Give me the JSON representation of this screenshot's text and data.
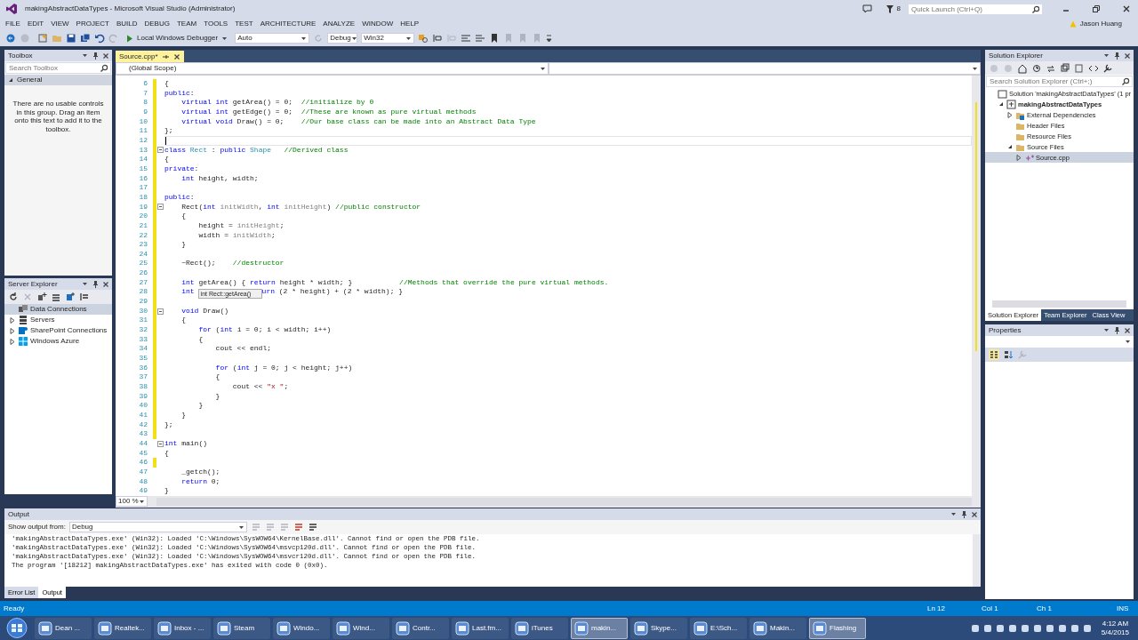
{
  "window": {
    "title": "makingAbstractDataTypes - Microsoft Visual Studio (Administrator)"
  },
  "notifications": {
    "count": "8"
  },
  "quick_launch": {
    "placeholder": "Quick Launch (Ctrl+Q)"
  },
  "menu": [
    "FILE",
    "EDIT",
    "VIEW",
    "PROJECT",
    "BUILD",
    "DEBUG",
    "TEAM",
    "TOOLS",
    "TEST",
    "ARCHITECTURE",
    "ANALYZE",
    "WINDOW",
    "HELP"
  ],
  "user": {
    "name": "Jason Huang"
  },
  "toolbar": {
    "debugger": "Local Windows Debugger",
    "dropdowns": [
      "Auto",
      "Debug",
      "Win32"
    ]
  },
  "toolbox": {
    "title": "Toolbox",
    "search": {
      "placeholder": "Search Toolbox"
    },
    "group": {
      "label": "General",
      "expanded": true
    },
    "empty_message": "There are no usable controls in this group. Drag an item onto this text to add it to the toolbox."
  },
  "server_explorer": {
    "title": "Server Explorer",
    "items": [
      {
        "label": "Data Connections",
        "kind": "data",
        "selected": true
      },
      {
        "label": "Servers",
        "kind": "servers",
        "expanded": false,
        "selected": false
      },
      {
        "label": "SharePoint Connections",
        "kind": "sharepoint",
        "expanded": false,
        "selected": false
      },
      {
        "label": "Windows Azure",
        "kind": "azure",
        "expanded": false,
        "selected": false
      }
    ]
  },
  "editor": {
    "tabs": [
      {
        "label": "Source.cpp*",
        "selected": true
      }
    ],
    "scope": "(Global Scope)",
    "zoom": "100 %",
    "lines": [
      {
        "num": "6",
        "changed": true,
        "fold": false,
        "current": false,
        "tokens": [
          "{"
        ]
      },
      {
        "num": "7",
        "changed": true,
        "fold": false,
        "current": false,
        "tokens": [
          {
            "kind": "kw",
            "text": "public"
          },
          ":"
        ]
      },
      {
        "num": "8",
        "changed": true,
        "fold": false,
        "current": false,
        "tokens": [
          {
            "kind": "kw",
            "text": "    virtual int"
          },
          " getArea() = 0;  ",
          {
            "kind": "cm",
            "text": "//initialize by 0"
          }
        ]
      },
      {
        "num": "9",
        "changed": true,
        "fold": false,
        "current": false,
        "tokens": [
          {
            "kind": "kw",
            "text": "    virtual int"
          },
          " getEdge() = 0;  ",
          {
            "kind": "cm",
            "text": "//These are known as pure virtual methods"
          }
        ]
      },
      {
        "num": "10",
        "changed": true,
        "fold": false,
        "current": false,
        "tokens": [
          {
            "kind": "kw",
            "text": "    virtual void"
          },
          " Draw() = 0;    ",
          {
            "kind": "cm",
            "text": "//Our base class can be made into an Abstract Data Type"
          }
        ]
      },
      {
        "num": "11",
        "changed": true,
        "fold": false,
        "current": false,
        "tokens": [
          "};"
        ]
      },
      {
        "num": "12",
        "changed": true,
        "fold": false,
        "current": true
      },
      {
        "num": "13",
        "changed": true,
        "fold": true,
        "current": false,
        "tokens": [
          {
            "kind": "kw",
            "text": "class "
          },
          {
            "kind": "type",
            "text": "Rect"
          },
          " : ",
          {
            "kind": "kw",
            "text": "public "
          },
          {
            "kind": "type",
            "text": "Shape   "
          },
          {
            "kind": "cm",
            "text": "//Derived class"
          }
        ]
      },
      {
        "num": "14",
        "changed": true,
        "fold": false,
        "current": false,
        "tokens": [
          "{"
        ]
      },
      {
        "num": "15",
        "changed": true,
        "fold": false,
        "current": false,
        "tokens": [
          {
            "kind": "kw",
            "text": "private"
          },
          ":"
        ]
      },
      {
        "num": "16",
        "changed": true,
        "fold": false,
        "current": false,
        "tokens": [
          {
            "kind": "kw",
            "text": "    int"
          },
          " height, width;"
        ]
      },
      {
        "num": "17",
        "changed": true,
        "fold": false,
        "current": false
      },
      {
        "num": "18",
        "changed": true,
        "fold": false,
        "current": false,
        "tokens": [
          {
            "kind": "kw",
            "text": "public"
          },
          ":"
        ]
      },
      {
        "num": "19",
        "changed": true,
        "fold": true,
        "current": false,
        "tokens": [
          "    Rect(",
          {
            "kind": "kw",
            "text": "int "
          },
          {
            "kind": "param",
            "text": "initWidth"
          },
          ", ",
          {
            "kind": "kw",
            "text": "int "
          },
          {
            "kind": "param",
            "text": "initHeight"
          },
          ") ",
          {
            "kind": "cm",
            "text": "//public constructor"
          }
        ]
      },
      {
        "num": "20",
        "changed": true,
        "fold": false,
        "current": false,
        "tokens": [
          "    {"
        ]
      },
      {
        "num": "21",
        "changed": true,
        "fold": false,
        "current": false,
        "tokens": [
          "        height = ",
          {
            "kind": "param",
            "text": "initHeight"
          },
          ";"
        ]
      },
      {
        "num": "22",
        "changed": true,
        "fold": false,
        "current": false,
        "tokens": [
          "        width = ",
          {
            "kind": "param",
            "text": "initWidth"
          },
          ";"
        ]
      },
      {
        "num": "23",
        "changed": true,
        "fold": false,
        "current": false,
        "tokens": [
          "    }"
        ]
      },
      {
        "num": "24",
        "changed": true,
        "fold": false,
        "current": false
      },
      {
        "num": "25",
        "changed": true,
        "fold": false,
        "current": false,
        "tokens": [
          "    ~Rect();    ",
          {
            "kind": "cm",
            "text": "//destructor"
          }
        ]
      },
      {
        "num": "26",
        "changed": true,
        "fold": false,
        "current": false
      },
      {
        "num": "27",
        "changed": true,
        "fold": false,
        "current": false,
        "tokens": [
          {
            "kind": "kw",
            "text": "    int"
          },
          " getArea() { ",
          {
            "kind": "kw",
            "text": "return"
          },
          " height * width; }           ",
          {
            "kind": "cm",
            "text": "//Methods that override the pure virtual methods."
          }
        ]
      },
      {
        "num": "28",
        "changed": true,
        "fold": false,
        "current": false,
        "tokens": [
          {
            "kind": "kw",
            "text": "    int"
          }
        ],
        "tooltip": "int Rect::getArea()",
        "tail": [
          {
            "kind": "kw",
            "text": "urn"
          },
          " (2 * height) + (2 * width); }"
        ]
      },
      {
        "num": "29",
        "changed": true,
        "fold": false,
        "current": false
      },
      {
        "num": "30",
        "changed": true,
        "fold": true,
        "current": false,
        "tokens": [
          {
            "kind": "kw",
            "text": "    void"
          },
          " Draw()"
        ]
      },
      {
        "num": "31",
        "changed": true,
        "fold": false,
        "current": false,
        "tokens": [
          "    {"
        ]
      },
      {
        "num": "32",
        "changed": true,
        "fold": false,
        "current": false,
        "tokens": [
          {
            "kind": "kw",
            "text": "        for"
          },
          " (",
          {
            "kind": "kw",
            "text": "int"
          },
          " i = 0; i < width; i++)"
        ]
      },
      {
        "num": "33",
        "changed": true,
        "fold": false,
        "current": false,
        "tokens": [
          "        {"
        ]
      },
      {
        "num": "34",
        "changed": true,
        "fold": false,
        "current": false,
        "tokens": [
          "            cout << endl;"
        ]
      },
      {
        "num": "35",
        "changed": true,
        "fold": false,
        "current": false
      },
      {
        "num": "36",
        "changed": true,
        "fold": false,
        "current": false,
        "tokens": [
          {
            "kind": "kw",
            "text": "            for"
          },
          " (",
          {
            "kind": "kw",
            "text": "int"
          },
          " j = 0; j < height; j++)"
        ]
      },
      {
        "num": "37",
        "changed": true,
        "fold": false,
        "current": false,
        "tokens": [
          "            {"
        ]
      },
      {
        "num": "38",
        "changed": true,
        "fold": false,
        "current": false,
        "tokens": [
          "                cout << ",
          {
            "kind": "str",
            "text": "\"x \""
          },
          ";"
        ]
      },
      {
        "num": "39",
        "changed": true,
        "fold": false,
        "current": false,
        "tokens": [
          "            }"
        ]
      },
      {
        "num": "40",
        "changed": true,
        "fold": false,
        "current": false,
        "tokens": [
          "        }"
        ]
      },
      {
        "num": "41",
        "changed": true,
        "fold": false,
        "current": false,
        "tokens": [
          "    }"
        ]
      },
      {
        "num": "42",
        "changed": true,
        "fold": false,
        "current": false,
        "tokens": [
          "};"
        ]
      },
      {
        "num": "43",
        "changed": true,
        "fold": false,
        "current": false
      },
      {
        "num": "44",
        "changed": false,
        "fold": true,
        "current": false,
        "tokens": [
          {
            "kind": "kw",
            "text": "int"
          },
          " main()"
        ]
      },
      {
        "num": "45",
        "changed": false,
        "fold": false,
        "current": false,
        "tokens": [
          "{"
        ]
      },
      {
        "num": "46",
        "changed": true,
        "fold": false,
        "current": false
      },
      {
        "num": "47",
        "changed": false,
        "fold": false,
        "current": false,
        "tokens": [
          "    _getch();"
        ]
      },
      {
        "num": "48",
        "changed": false,
        "fold": false,
        "current": false,
        "tokens": [
          {
            "kind": "kw",
            "text": "    return"
          },
          " 0;"
        ]
      },
      {
        "num": "49",
        "changed": false,
        "fold": false,
        "current": false,
        "tokens": [
          "}"
        ]
      }
    ]
  },
  "solution_explorer": {
    "title": "Solution Explorer",
    "search": {
      "placeholder": "Search Solution Explorer (Ctrl+;)"
    },
    "tree": [
      {
        "label": "Solution 'makingAbstractDataTypes' (1 pr",
        "kind": "solution",
        "selected": false,
        "children": [
          {
            "label": "makingAbstractDataTypes",
            "kind": "project",
            "expanded": true,
            "selected": false,
            "children": [
              {
                "label": "External Dependencies",
                "kind": "deps",
                "expanded": false,
                "selected": false
              },
              {
                "label": "Header Files",
                "kind": "folder",
                "selected": false
              },
              {
                "label": "Resource Files",
                "kind": "folder",
                "selected": false
              },
              {
                "label": "Source Files",
                "kind": "folder",
                "expanded": true,
                "selected": false,
                "children": [
                  {
                    "label": "Source.cpp",
                    "kind": "file",
                    "expanded": false,
                    "selected": true
                  }
                ]
              }
            ]
          }
        ]
      }
    ],
    "tabs": [
      {
        "label": "Solution Explorer",
        "selected": true
      },
      {
        "label": "Team Explorer",
        "selected": false
      },
      {
        "label": "Class View",
        "selected": false
      }
    ]
  },
  "properties": {
    "title": "Properties"
  },
  "output": {
    "title": "Output",
    "source_label": "Show output from:",
    "source": "Debug",
    "lines": [
      "'makingAbstractDataTypes.exe' (Win32): Loaded 'C:\\Windows\\SysWOW64\\KernelBase.dll'. Cannot find or open the PDB file.",
      "'makingAbstractDataTypes.exe' (Win32): Loaded 'C:\\Windows\\SysWOW64\\msvcp120d.dll'. Cannot find or open the PDB file.",
      "'makingAbstractDataTypes.exe' (Win32): Loaded 'C:\\Windows\\SysWOW64\\msvcr120d.dll'. Cannot find or open the PDB file.",
      "The program '[18212] makingAbstractDataTypes.exe' has exited with code 0 (0x0)."
    ]
  },
  "bottom_tabs": [
    {
      "label": "Error List",
      "selected": false
    },
    {
      "label": "Output",
      "selected": true
    }
  ],
  "status_bar": {
    "state": "Ready",
    "line": "Ln 12",
    "column": "Col 1",
    "char": "Ch 1",
    "mode": "INS"
  },
  "taskbar": {
    "items": [
      {
        "label": "Dean ...",
        "selected": false
      },
      {
        "label": "Realtek...",
        "selected": false
      },
      {
        "label": "Inbox - ...",
        "selected": false
      },
      {
        "label": "Steam",
        "selected": false
      },
      {
        "label": "Windo...",
        "selected": false
      },
      {
        "label": "Wind...",
        "selected": false
      },
      {
        "label": "Contr...",
        "selected": false
      },
      {
        "label": "Last.fm...",
        "selected": false
      },
      {
        "label": "iTunes",
        "selected": false
      },
      {
        "label": "makin...",
        "selected": true
      },
      {
        "label": "Skype...",
        "selected": false
      },
      {
        "label": "E:\\Sch...",
        "selected": false
      },
      {
        "label": "Makin...",
        "selected": false
      },
      {
        "label": "Flashing",
        "selected": true
      }
    ],
    "clock": {
      "time": "4:12 AM",
      "date": "5/4/2015"
    }
  }
}
